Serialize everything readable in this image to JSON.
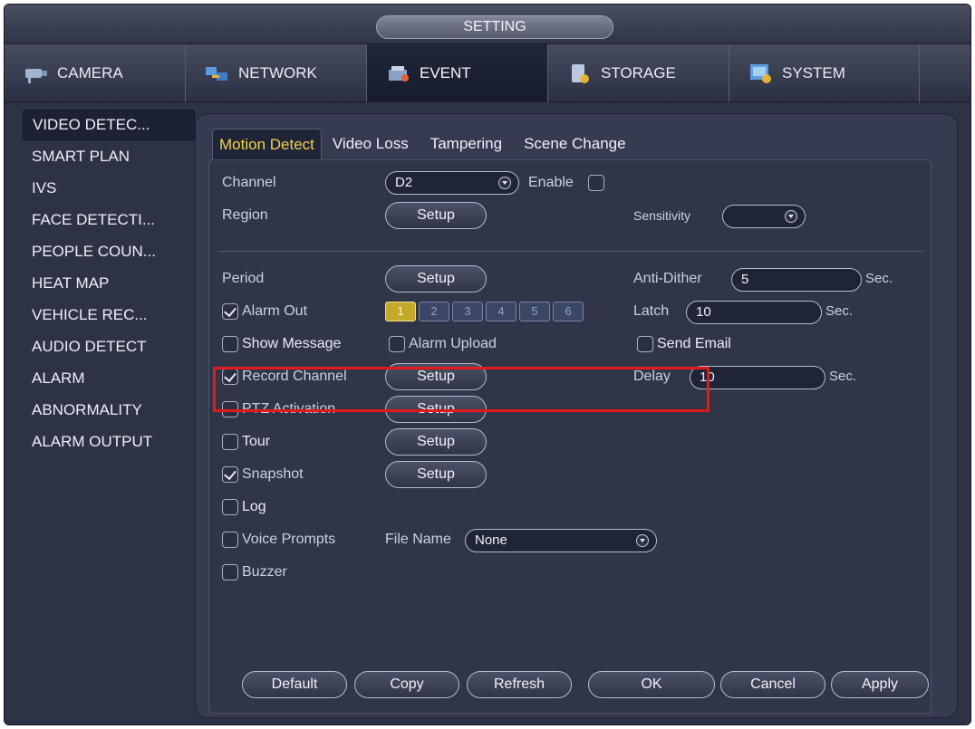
{
  "window": {
    "title": "SETTING"
  },
  "tabs": [
    {
      "label": "CAMERA",
      "icon": "camera-icon"
    },
    {
      "label": "NETWORK",
      "icon": "network-icon"
    },
    {
      "label": "EVENT",
      "icon": "event-icon",
      "active": true
    },
    {
      "label": "STORAGE",
      "icon": "storage-icon"
    },
    {
      "label": "SYSTEM",
      "icon": "system-icon"
    }
  ],
  "sidebar": {
    "items": [
      {
        "label": "VIDEO DETEC...",
        "active": true
      },
      {
        "label": "SMART PLAN"
      },
      {
        "label": "IVS"
      },
      {
        "label": "FACE DETECTI..."
      },
      {
        "label": "PEOPLE COUN..."
      },
      {
        "label": "HEAT MAP"
      },
      {
        "label": "VEHICLE REC..."
      },
      {
        "label": "AUDIO DETECT"
      },
      {
        "label": "ALARM"
      },
      {
        "label": "ABNORMALITY"
      },
      {
        "label": "ALARM OUTPUT"
      }
    ]
  },
  "subtabs": [
    {
      "label": "Motion Detect",
      "active": true
    },
    {
      "label": "Video Loss"
    },
    {
      "label": "Tampering"
    },
    {
      "label": "Scene Change"
    }
  ],
  "form": {
    "channel_label": "Channel",
    "channel_value": "D2",
    "enable_label": "Enable",
    "enable_checked": false,
    "region_label": "Region",
    "sensitivity_label": "Sensitivity",
    "sensitivity_value": "",
    "period_label": "Period",
    "anti_dither_label": "Anti-Dither",
    "anti_dither_value": "5",
    "sec_label": "Sec.",
    "alarm_out_label": "Alarm Out",
    "alarm_out_checked": true,
    "alarm_out_channels": [
      "1",
      "2",
      "3",
      "4",
      "5",
      "6"
    ],
    "alarm_out_selected": "1",
    "latch_label": "Latch",
    "latch_value": "10",
    "show_message_label": "Show Message",
    "alarm_upload_label": "Alarm Upload",
    "send_email_label": "Send Email",
    "record_channel_label": "Record Channel",
    "record_channel_checked": true,
    "delay_label": "Delay",
    "delay_value": "10",
    "ptz_label": "PTZ Activation",
    "tour_label": "Tour",
    "snapshot_label": "Snapshot",
    "snapshot_checked": true,
    "log_label": "Log",
    "voice_prompts_label": "Voice Prompts",
    "file_name_label": "File Name",
    "file_name_value": "None",
    "buzzer_label": "Buzzer",
    "setup_label": "Setup"
  },
  "footer": {
    "default": "Default",
    "copy": "Copy",
    "refresh": "Refresh",
    "ok": "OK",
    "cancel": "Cancel",
    "apply": "Apply"
  },
  "colors": {
    "active_subtab_text": "#f1d24a",
    "highlight_border": "#e3191b"
  }
}
